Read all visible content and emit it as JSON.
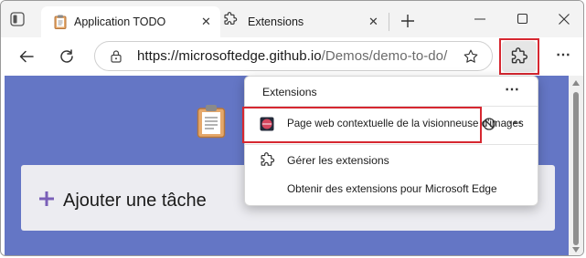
{
  "browser": {
    "tabs": [
      {
        "title": "Application TODO",
        "icon": "clipboard-icon",
        "active": true
      },
      {
        "title": "Extensions",
        "icon": "puzzle-piece-icon",
        "active": false
      }
    ],
    "address_bar": {
      "url_host": "https://microsoftedge.github.io",
      "url_path": "/Demos/demo-to-do/"
    }
  },
  "extensions_menu": {
    "header": "Extensions",
    "items": [
      {
        "label": "Page web contextuelle de la visionneuse d'images",
        "highlighted": true
      },
      {
        "label": "Gérer les extensions"
      },
      {
        "label": "Obtenir des extensions pour Microsoft Edge"
      }
    ]
  },
  "page": {
    "add_task_label": "Ajouter une tâche"
  },
  "colors": {
    "page_background": "#6476c5",
    "highlight_border": "#d62730",
    "add_icon": "#7a5fb8"
  }
}
